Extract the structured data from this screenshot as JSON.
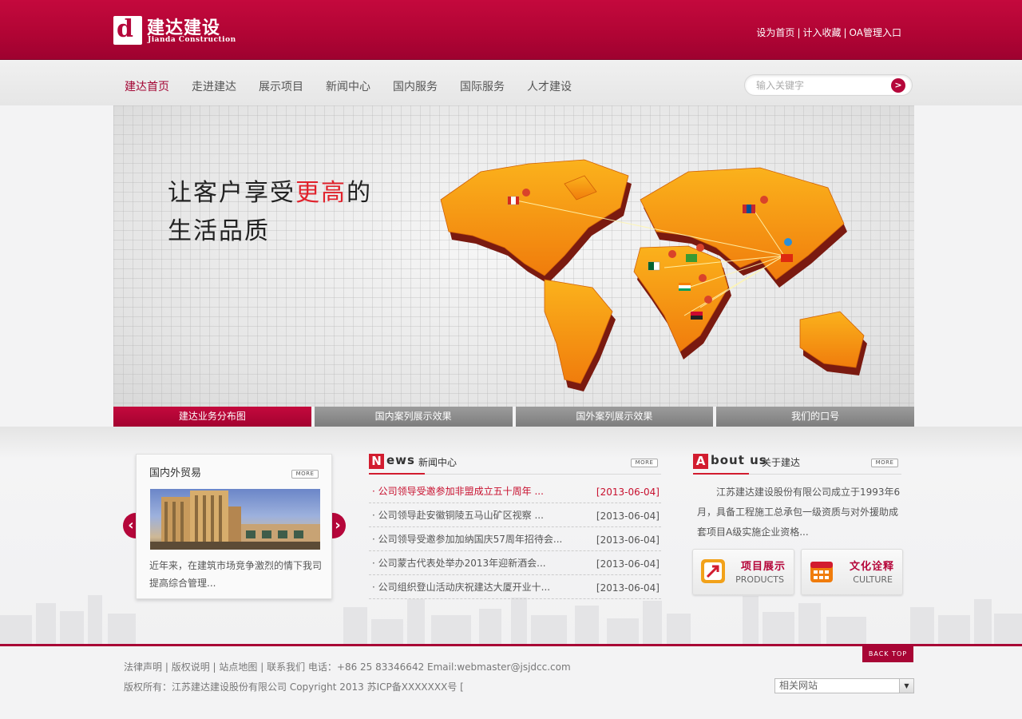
{
  "brand": {
    "logo_letter": "d",
    "name_cn": "建达建设",
    "name_en": "Jianda Construction"
  },
  "top_links": [
    "设为首页",
    "计入收藏",
    "OA管理入口"
  ],
  "nav": {
    "items": [
      "建达首页",
      "走进建达",
      "展示项目",
      "新闻中心",
      "国内服务",
      "国际服务",
      "人才建设"
    ],
    "active_index": 0
  },
  "search": {
    "placeholder": "输入关键字",
    "button_glyph": ">"
  },
  "banner": {
    "slogan_line1_pre": "让客户享受",
    "slogan_line1_hl": "更高",
    "slogan_line1_post": "的",
    "slogan_line2": "生活品质",
    "tabs": [
      "建达业务分布图",
      "国内案列展示效果",
      "国外案列展示效果",
      "我们的口号"
    ],
    "active_tab": 0
  },
  "trade": {
    "title": "国内外贸易",
    "more": "MORE",
    "text": "近年来，在建筑市场竞争激烈的情下我司提高综合管理...",
    "prev_glyph": "‹",
    "next_glyph": "›"
  },
  "news": {
    "cap": "N",
    "word": "ews",
    "cn": "新闻中心",
    "more": "MORE",
    "items": [
      {
        "title": "· 公司领导受邀参加非盟成立五十周年 ...",
        "date": "[2013-06-04]",
        "hot": true
      },
      {
        "title": "· 公司领导赴安徽铜陵五马山矿区视察 ...",
        "date": "[2013-06-04]",
        "hot": false
      },
      {
        "title": "· 公司领导受邀参加加纳国庆57周年招待会...",
        "date": "[2013-06-04]",
        "hot": false
      },
      {
        "title": "· 公司蒙古代表处举办2013年迎新酒会...",
        "date": "[2013-06-04]",
        "hot": false
      },
      {
        "title": "· 公司组织登山活动庆祝建达大厦开业十...",
        "date": "[2013-06-04]",
        "hot": false
      }
    ]
  },
  "about": {
    "cap": "A",
    "word": "bout us",
    "cn": "关于建达",
    "more": "MORE",
    "text": "江苏建达建设股份有限公司成立于1993年6月，具备工程施工总承包一级资质与对外援助成套项目A级实施企业资格...",
    "features": [
      {
        "cn": "项目展示",
        "en": "PRODUCTS",
        "icon": "products-icon"
      },
      {
        "cn": "文化诠释",
        "en": "CULTURE",
        "icon": "calendar-icon"
      }
    ]
  },
  "footer": {
    "back_top": "BACK TOP",
    "links": [
      "法律声明",
      "版权说明",
      "站点地图",
      "联系我们"
    ],
    "contact": "电话：+86 25 83346642 Email:webmaster@jsjdcc.com",
    "copyright": "版权所有：江苏建达建设股份有限公司 Copyright 2013 苏ICP备XXXXXXX号 [",
    "related_label": "相关网站"
  },
  "colors": {
    "brand_red": "#b5063a",
    "accent_red": "#d21c2f",
    "map_orange": "#f79a10"
  }
}
